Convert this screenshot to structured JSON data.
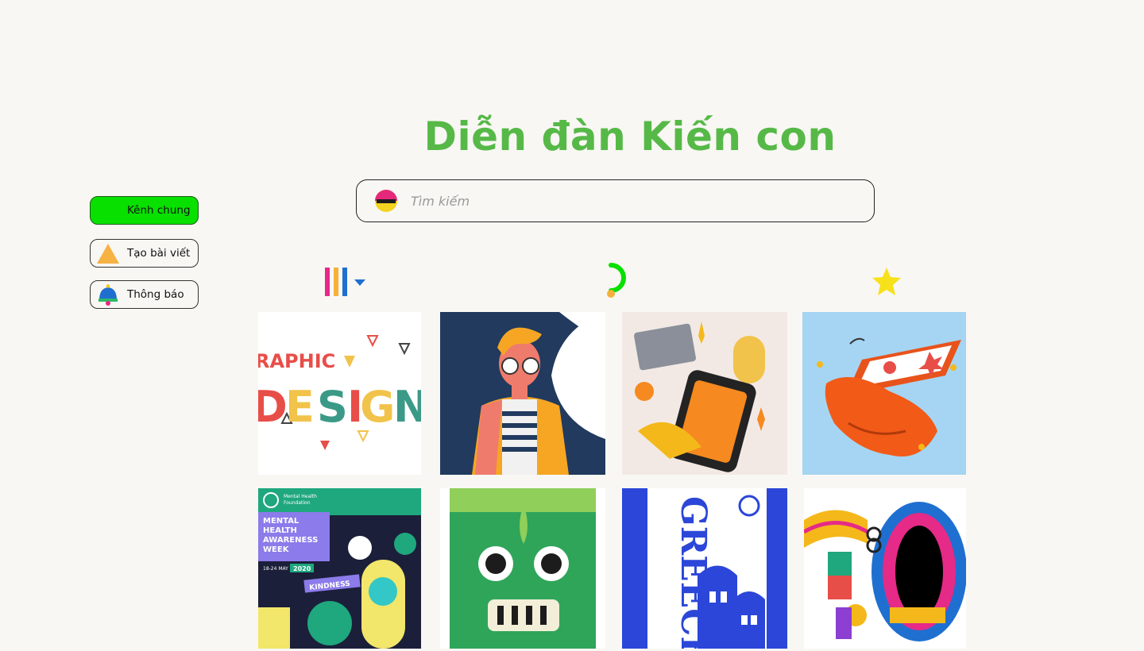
{
  "page": {
    "title": "Diễn đàn Kiến con"
  },
  "search": {
    "placeholder": "Tìm kiếm",
    "value": ""
  },
  "sidebar": {
    "items": [
      {
        "label": "Kênh chung",
        "icon": "channel-icon",
        "active": true
      },
      {
        "label": "Tạo bài viết",
        "icon": "triangle-icon",
        "active": false
      },
      {
        "label": "Thông báo",
        "icon": "bell-icon",
        "active": false
      }
    ]
  },
  "toolbar": {
    "items": [
      {
        "icon": "bars-filter-icon"
      },
      {
        "icon": "loading-refresh-icon"
      },
      {
        "icon": "star-icon"
      }
    ]
  },
  "gallery": {
    "items": [
      {
        "text": "RAPHIC DESIGN"
      },
      {
        "text": ""
      },
      {
        "text": ""
      },
      {
        "text": ""
      },
      {
        "text": "Mental Health Foundation MENTAL HEALTH AWARENESS WEEK 18-24 MAY 2020 KINDNESS"
      },
      {
        "text": ""
      },
      {
        "text": "GREECE"
      },
      {
        "text": ""
      }
    ]
  },
  "colors": {
    "brand_green": "#56b947",
    "active_green": "#08e000",
    "background": "#f8f7f3"
  }
}
